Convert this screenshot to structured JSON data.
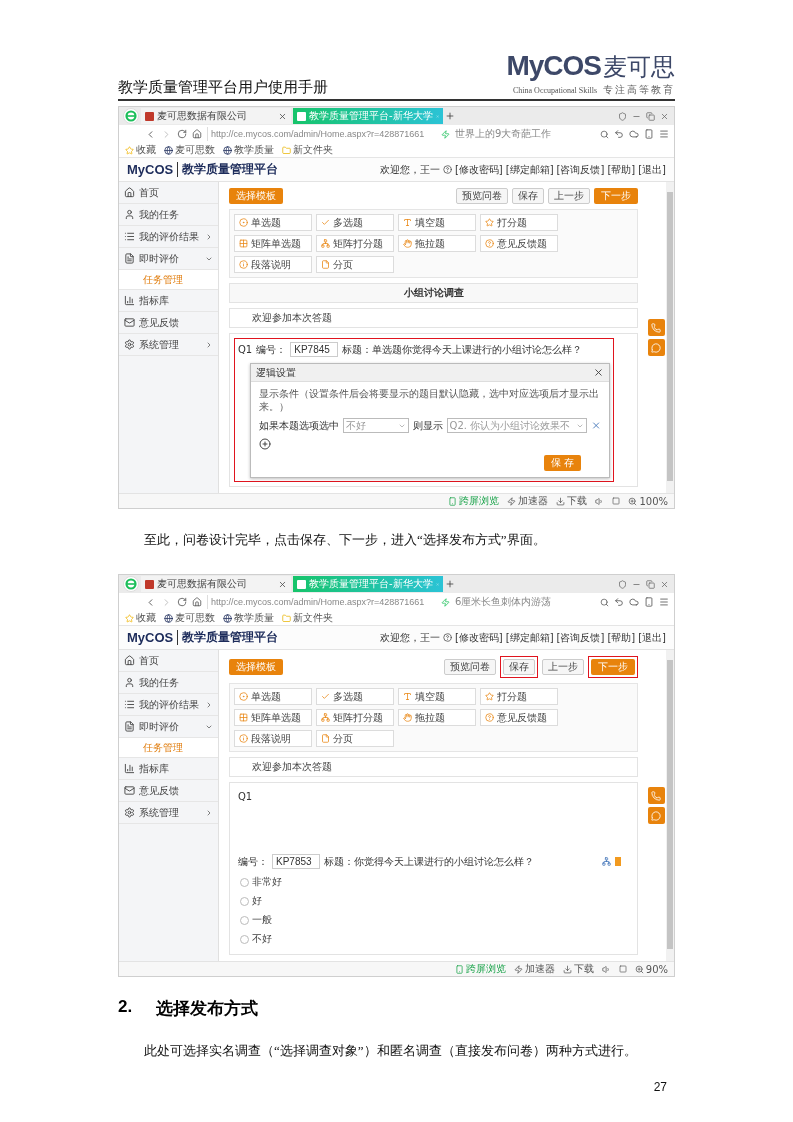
{
  "document_header": {
    "title": "教学质量管理平台用户使用手册",
    "logo": {
      "brand": "MyCOS",
      "name": "麦可思",
      "tagline": "China Occupational Skills",
      "slogan": "专注高等教育"
    }
  },
  "blocks": [
    {
      "kind": "screenshot",
      "browser": {
        "tabs": [
          {
            "label": "麦可思数据有限公司",
            "selected": false
          },
          {
            "label": "教学质量管理平台-新华大学",
            "selected": true
          }
        ],
        "url": "http://ce.mycos.com/admin/Home.aspx?r=428871661",
        "search": "世界上的9大奇葩工作",
        "bookmarks": [
          {
            "kind": "star",
            "label": "收藏"
          },
          {
            "kind": "site",
            "label": "麦可思数"
          },
          {
            "kind": "site",
            "label": "教学质量"
          },
          {
            "kind": "folder",
            "label": "新文件夹"
          }
        ],
        "status": [
          {
            "kind": "crossscreen",
            "label": "跨屏浏览"
          },
          {
            "kind": "accel",
            "label": "加速器"
          },
          {
            "kind": "download",
            "label": "下载"
          }
        ],
        "zoom": "100%"
      },
      "app": {
        "brand": "MyCOS",
        "title": "教学质量管理平台",
        "welcome": "欢迎您，王一",
        "links": [
          "[修改密码]",
          "[绑定邮箱]",
          "[咨询反馈]",
          "[帮助]",
          "[退出]"
        ],
        "sidebar": [
          {
            "kind": "home",
            "label": "首页",
            "expanded": false,
            "submenu": false
          },
          {
            "kind": "user",
            "label": "我的任务",
            "expanded": false,
            "submenu": false
          },
          {
            "kind": "list",
            "label": "我的评价结果",
            "expanded": false,
            "submenu": true
          },
          {
            "kind": "doc",
            "label": "即时评价",
            "expanded": true,
            "submenu": true,
            "children": [
              {
                "label": "任务管理",
                "selected": true
              }
            ]
          },
          {
            "kind": "chart",
            "label": "指标库",
            "expanded": false,
            "submenu": false
          },
          {
            "kind": "mail",
            "label": "意见反馈",
            "expanded": false,
            "submenu": false
          },
          {
            "kind": "gear",
            "label": "系统管理",
            "expanded": false,
            "submenu": true
          }
        ],
        "template_button": "选择模板",
        "actions": [
          {
            "kind": "plain",
            "label": "预览问卷",
            "highlighted": false
          },
          {
            "kind": "plain",
            "label": "保存",
            "highlighted": false
          },
          {
            "kind": "plain",
            "label": "上一步",
            "highlighted": false
          },
          {
            "kind": "primary",
            "label": "下一步",
            "highlighted": false
          }
        ],
        "question_types": [
          {
            "kind": "radio",
            "label": "单选题"
          },
          {
            "kind": "check",
            "label": "多选题"
          },
          {
            "kind": "fill",
            "label": "填空题"
          },
          {
            "kind": "rating",
            "label": "打分题"
          },
          {
            "kind": "matrix",
            "label": "矩阵单选题"
          },
          {
            "kind": "matrixrating",
            "label": "矩阵打分题"
          },
          {
            "kind": "drag",
            "label": "拖拉题"
          },
          {
            "kind": "feedback",
            "label": "意见反馈题"
          },
          {
            "kind": "note",
            "label": "段落说明"
          },
          {
            "kind": "pagebreak",
            "label": "分页"
          }
        ],
        "survey_title": "小组讨论调查",
        "welcome_text": "欢迎参加本次答题",
        "question": {
          "number": "Q1",
          "code_label": "编号：",
          "code": "KP7845",
          "title": "标题：单选题你觉得今天上课进行的小组讨论怎么样？",
          "highlighted": true,
          "logic_dialog": {
            "title": "逻辑设置",
            "hint": "显示条件（设置条件后会将要显示的题目默认隐藏，选中对应选项后才显示出来。）",
            "if_label": "如果本题选项选中",
            "option_value": "不好",
            "then_label": "则显示",
            "target_value": "Q2. 你认为小组讨论效果不",
            "save": "保 存"
          }
        }
      }
    },
    {
      "kind": "paragraph",
      "text": "至此，问卷设计完毕，点击保存、下一步，进入“选择发布方式”界面。"
    },
    {
      "kind": "screenshot",
      "browser": {
        "tabs": [
          {
            "label": "麦可思数据有限公司",
            "selected": false
          },
          {
            "label": "教学质量管理平台-新华大学",
            "selected": true
          }
        ],
        "url": "http://ce.mycos.com/admin/Home.aspx?r=428871661",
        "search": "6厘米长鱼刺体内游荡",
        "bookmarks": [
          {
            "kind": "star",
            "label": "收藏"
          },
          {
            "kind": "site",
            "label": "麦可思数"
          },
          {
            "kind": "site",
            "label": "教学质量"
          },
          {
            "kind": "folder",
            "label": "新文件夹"
          }
        ],
        "status": [
          {
            "kind": "crossscreen",
            "label": "跨屏浏览"
          },
          {
            "kind": "accel",
            "label": "加速器"
          },
          {
            "kind": "download",
            "label": "下载"
          }
        ],
        "zoom": "90%"
      },
      "app": {
        "brand": "MyCOS",
        "title": "教学质量管理平台",
        "welcome": "欢迎您，王一",
        "links": [
          "[修改密码]",
          "[绑定邮箱]",
          "[咨询反馈]",
          "[帮助]",
          "[退出]"
        ],
        "sidebar": [
          {
            "kind": "home",
            "label": "首页",
            "expanded": false,
            "submenu": false
          },
          {
            "kind": "user",
            "label": "我的任务",
            "expanded": false,
            "submenu": false
          },
          {
            "kind": "list",
            "label": "我的评价结果",
            "expanded": false,
            "submenu": true
          },
          {
            "kind": "doc",
            "label": "即时评价",
            "expanded": true,
            "submenu": true,
            "children": [
              {
                "label": "任务管理",
                "selected": true
              }
            ]
          },
          {
            "kind": "chart",
            "label": "指标库",
            "expanded": false,
            "submenu": false
          },
          {
            "kind": "mail",
            "label": "意见反馈",
            "expanded": false,
            "submenu": false
          },
          {
            "kind": "gear",
            "label": "系统管理",
            "expanded": false,
            "submenu": true
          }
        ],
        "template_button": "选择模板",
        "actions": [
          {
            "kind": "plain",
            "label": "预览问卷",
            "highlighted": false
          },
          {
            "kind": "plain",
            "label": "保存",
            "highlighted": true
          },
          {
            "kind": "plain",
            "label": "上一步",
            "highlighted": false
          },
          {
            "kind": "primary",
            "label": "下一步",
            "highlighted": true
          }
        ],
        "question_types": [
          {
            "kind": "radio",
            "label": "单选题"
          },
          {
            "kind": "check",
            "label": "多选题"
          },
          {
            "kind": "fill",
            "label": "填空题"
          },
          {
            "kind": "rating",
            "label": "打分题"
          },
          {
            "kind": "matrix",
            "label": "矩阵单选题"
          },
          {
            "kind": "matrixrating",
            "label": "矩阵打分题"
          },
          {
            "kind": "drag",
            "label": "拖拉题"
          },
          {
            "kind": "feedback",
            "label": "意见反馈题"
          },
          {
            "kind": "note",
            "label": "段落说明"
          },
          {
            "kind": "pagebreak",
            "label": "分页"
          }
        ],
        "welcome_text": "欢迎参加本次答题",
        "question": {
          "number": "Q1",
          "code_label": "编号：",
          "code": "KP7853",
          "title": "标题：你觉得今天上课进行的小组讨论怎么样？",
          "highlighted": false,
          "options": [
            {
              "label": "非常好",
              "checked": false
            },
            {
              "label": "好",
              "checked": false
            },
            {
              "label": "一般",
              "checked": false
            },
            {
              "label": "不好",
              "checked": false
            }
          ]
        }
      }
    },
    {
      "kind": "heading",
      "number": "2.",
      "text": "选择发布方式"
    },
    {
      "kind": "paragraph",
      "text": "此处可选择实名调查（“选择调查对象”）和匿名调查（直接发布问卷）两种方式进行。"
    }
  ],
  "page_number": "27"
}
